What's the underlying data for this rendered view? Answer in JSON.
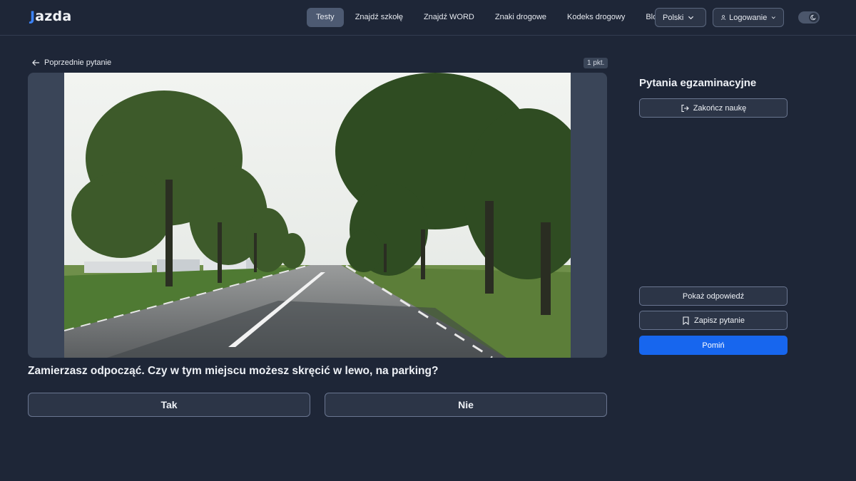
{
  "header": {
    "logo_mark": "J",
    "logo_rest": "azda",
    "nav": [
      "Testy",
      "Znajdź szkołę",
      "Znajdź WORD",
      "Znaki drogowe",
      "Kodeks drogowy",
      "Blog"
    ],
    "active_nav": 0,
    "language": "Polski",
    "login": "Logowanie"
  },
  "main": {
    "prev_link": "Poprzednie pytanie",
    "points": "1 pkt.",
    "question": "Zamierzasz odpocząć. Czy w tym miejscu możesz skręcić w lewo, na parking?",
    "answers": [
      "Tak",
      "Nie"
    ]
  },
  "sidebar": {
    "title": "Pytania egzaminacyjne",
    "finish": "Zakończ naukę",
    "show_answer": "Pokaż odpowiedź",
    "save_question": "Zapisz pytanie",
    "skip": "Pomiń"
  },
  "colors": {
    "background": "#1e2637",
    "accent": "#1766ee",
    "logo_accent": "#3b82f6"
  }
}
